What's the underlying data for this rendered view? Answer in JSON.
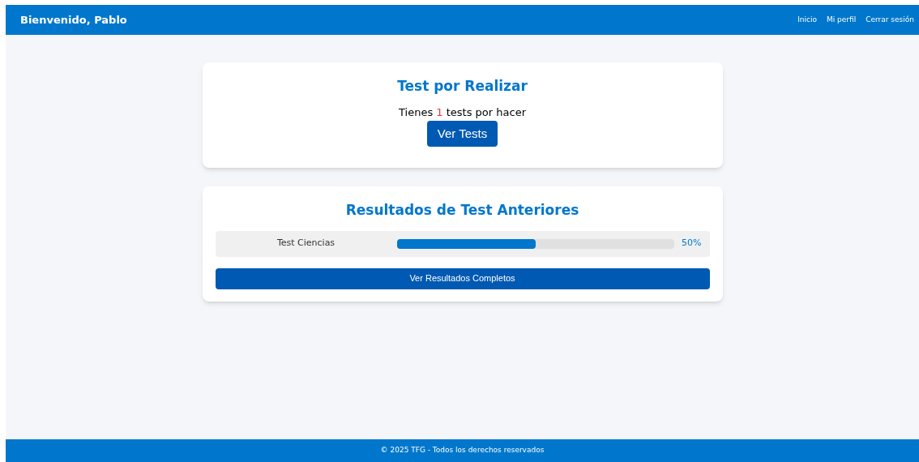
{
  "header": {
    "title": "Bienvenido, Pablo",
    "nav": [
      "Inicio",
      "Mi perfil",
      "Cerrar sesión"
    ]
  },
  "pending": {
    "title": "Test por Realizar",
    "message": {
      "before": "Tienes ",
      "count": "1",
      "after": " tests por hacer"
    },
    "button": "Ver Tests"
  },
  "results": {
    "title": "Resultados de Test Anteriores",
    "rows": [
      {
        "name": "Test Ciencias",
        "level": 0.5,
        "reading": "50%"
      }
    ],
    "button": "Ver Resultados Completos"
  },
  "footer": "© 2025 TFG - Todos los derechos reservados"
}
